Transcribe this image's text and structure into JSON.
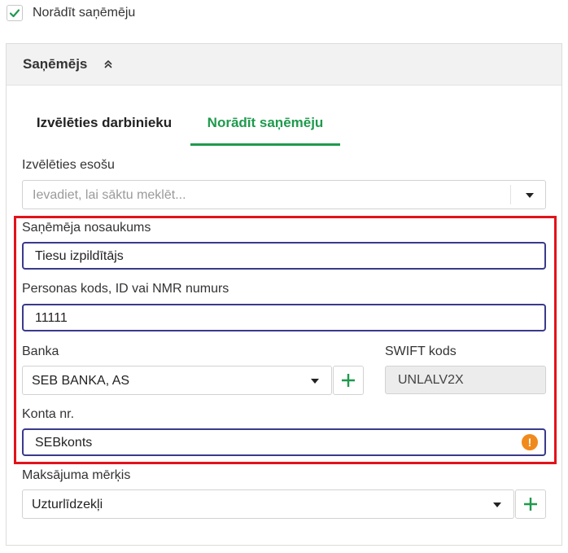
{
  "show_recipient_checkbox": {
    "label": "Norādīt saņēmēju",
    "checked": true
  },
  "panel": {
    "title": "Saņēmējs"
  },
  "tabs": [
    {
      "label": "Izvēlēties darbinieku",
      "active": false
    },
    {
      "label": "Norādīt saņēmēju",
      "active": true
    }
  ],
  "choose_existing": {
    "label": "Izvēlēties esošu",
    "placeholder": "Ievadiet, lai sāktu meklēt..."
  },
  "recipient_name": {
    "label": "Saņēmēja nosaukums",
    "value": "Tiesu izpildītājs"
  },
  "personal_code": {
    "label": "Personas kods, ID vai NMR numurs",
    "value": "11111"
  },
  "bank": {
    "label": "Banka",
    "value": "SEB BANKA, AS"
  },
  "swift": {
    "label": "SWIFT kods",
    "value": "UNLALV2X"
  },
  "account": {
    "label": "Konta nr.",
    "value": "SEBkonts",
    "warning_icon": "!"
  },
  "payment_purpose": {
    "label": "Maksājuma mērķis",
    "value": "Uzturlīdzekļi"
  },
  "colors": {
    "accent": "#1f9a4d",
    "input_border": "#3a3a8c",
    "highlight": "#e3121a",
    "warning": "#f08a1c"
  }
}
